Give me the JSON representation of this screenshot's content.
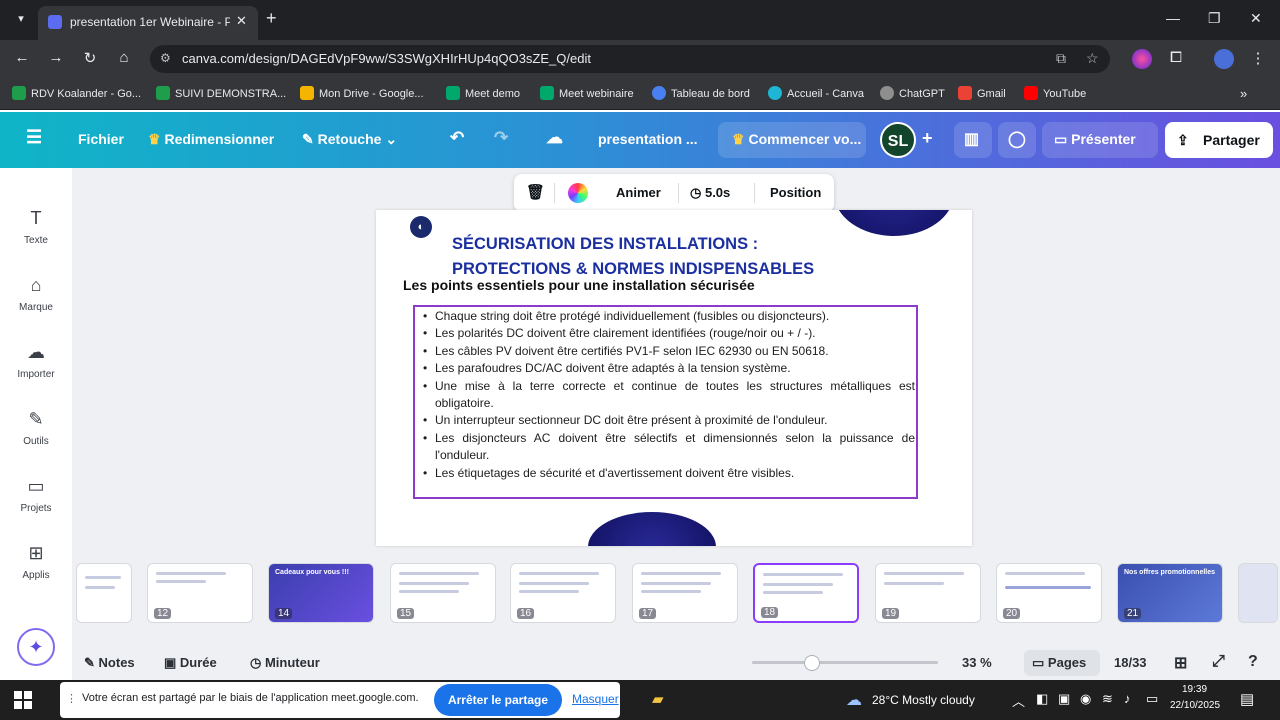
{
  "browser": {
    "tab_title": "presentation 1er Webinaire - P",
    "url_host": "canva.com",
    "url_path": "/design/DAGEdVpF9ww/S3SWgXHIrHUp4qQO3sZE_Q/edit",
    "bookmarks": [
      "RDV Koalander - Go...",
      "SUIVI DEMONSTRA...",
      "Mon Drive - Google...",
      "Meet demo",
      "Meet webinaire",
      "Tableau de bord",
      "Accueil - Canva",
      "ChatGPT",
      "Gmail",
      "YouTube"
    ]
  },
  "canva_header": {
    "fichier": "Fichier",
    "redimensionner": "Redimensionner",
    "retouche": "Retouche",
    "doc_title": "presentation ...",
    "commencer": "Commencer vo...",
    "avatar": "SL",
    "presenter": "Présenter",
    "partager": "Partager"
  },
  "sidebar": {
    "items": [
      {
        "label": "Texte",
        "icon": "T"
      },
      {
        "label": "Marque",
        "icon": "⌂"
      },
      {
        "label": "Importer",
        "icon": "☁"
      },
      {
        "label": "Outils",
        "icon": "✎"
      },
      {
        "label": "Projets",
        "icon": "▭"
      },
      {
        "label": "Applis",
        "icon": "⊞"
      }
    ]
  },
  "floating_toolbar": {
    "animer": "Animer",
    "duration": "5.0s",
    "position": "Position"
  },
  "slide": {
    "title_line1": "SÉCURISATION DES INSTALLATIONS :",
    "title_line2": "PROTECTIONS & NORMES INDISPENSABLES",
    "subtitle": "Les points essentiels pour une installation sécurisée",
    "bullets": [
      "Chaque string doit être protégé individuellement (fusibles ou disjoncteurs).",
      "Les polarités DC doivent être clairement identifiées (rouge/noir ou + / -).",
      "Les câbles PV doivent être certifiés PV1-F selon IEC 62930 ou EN 50618.",
      "Les parafoudres DC/AC doivent être adaptés à la tension système.",
      "Une mise à la terre correcte et continue de toutes les structures métalliques est obligatoire.",
      "Un interrupteur sectionneur DC doit être présent à proximité de l'onduleur.",
      "Les disjoncteurs AC doivent être sélectifs et dimensionnés selon la puissance de l'onduleur.",
      "Les étiquetages de sécurité et d'avertissement doivent être visibles."
    ]
  },
  "thumbnails": [
    {
      "num": "12"
    },
    {
      "num": "14"
    },
    {
      "num": "15"
    },
    {
      "num": "16"
    },
    {
      "num": "17"
    },
    {
      "num": "18"
    },
    {
      "num": "19"
    },
    {
      "num": "20"
    },
    {
      "num": "21"
    }
  ],
  "thumb_text": {
    "cadeaux": "Cadeaux pour vous !!!",
    "offres": "Nos offres promotionnelles"
  },
  "bottom_bar": {
    "notes": "Notes",
    "duree": "Durée",
    "minuteur": "Minuteur",
    "zoom": "33 %",
    "pages": "Pages",
    "page_count": "18/33",
    "zoom_level": 0.33
  },
  "screen_share": {
    "message": "Votre écran est partagé par le biais de l'application meet.google.com.",
    "stop": "Arrêter le partage",
    "hide": "Masquer"
  },
  "taskbar": {
    "weather": "28°C  Mostly cloudy",
    "time": "19:39",
    "date": "22/10/2025"
  },
  "colors": {
    "accent": "#8b3dff",
    "title_blue": "#1c2fa0",
    "box_border": "#8e3bcc",
    "share_blue": "#1a73e8"
  }
}
